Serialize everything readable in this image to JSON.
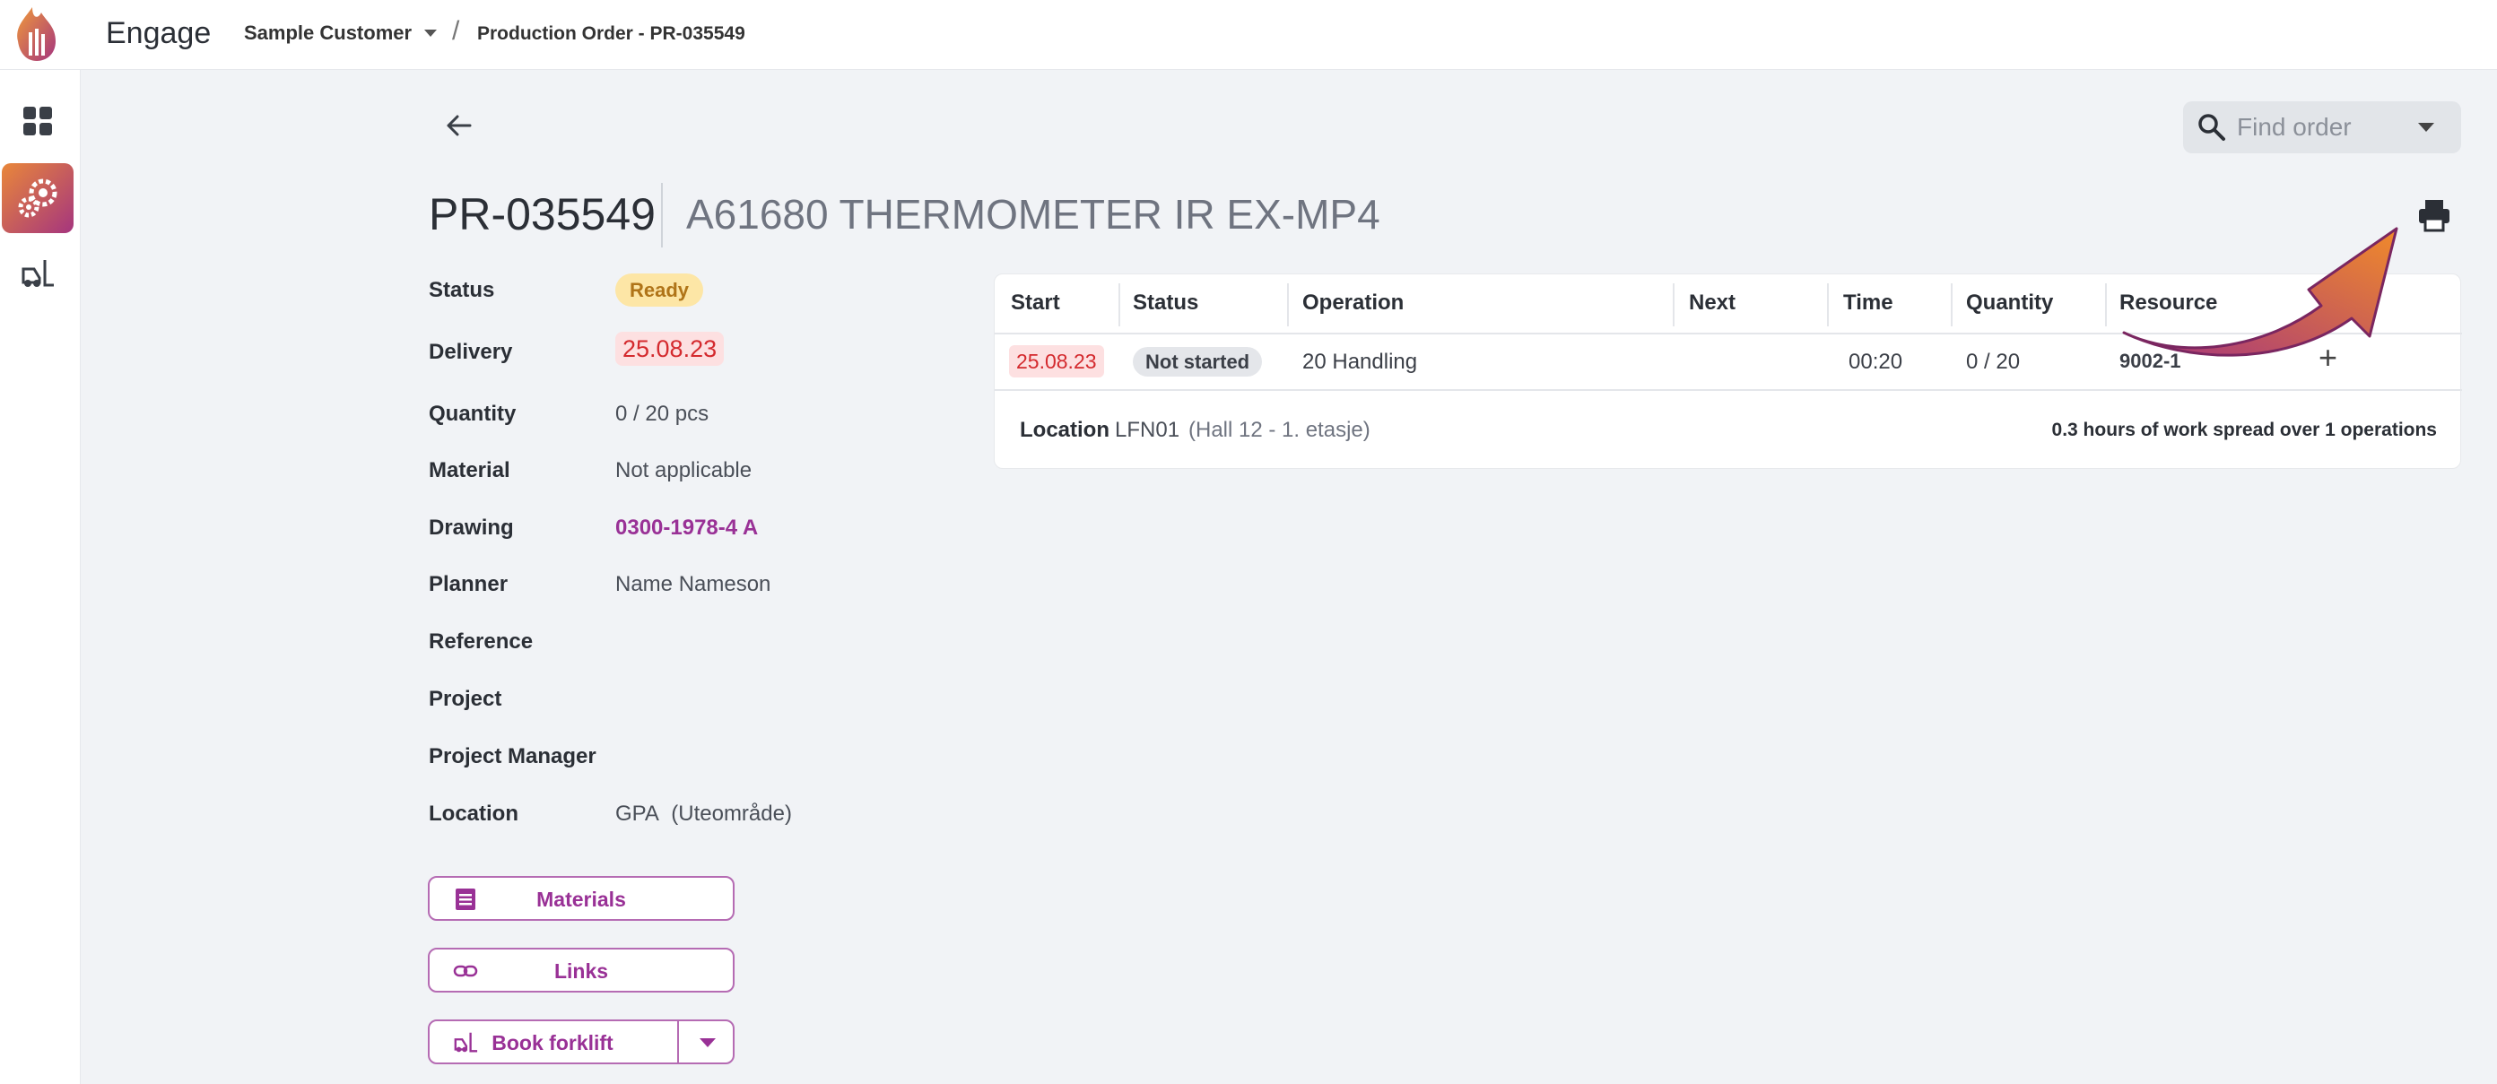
{
  "header": {
    "app_title": "Engage",
    "customer": "Sample Customer",
    "breadcrumb_sep": "/",
    "breadcrumb": "Production Order - PR-035549"
  },
  "sidebar": {
    "items": [
      {
        "icon": "dashboard-icon"
      },
      {
        "icon": "production-gear-icon",
        "active": true
      },
      {
        "icon": "forklift-icon"
      }
    ]
  },
  "search": {
    "placeholder": "Find order"
  },
  "order": {
    "number": "PR-035549",
    "description": "A61680 THERMOMETER IR EX-MP4"
  },
  "details": {
    "status_label": "Status",
    "status_value": "Ready",
    "delivery_label": "Delivery",
    "delivery_value": "25.08.23",
    "quantity_label": "Quantity",
    "quantity_value": "0 / 20 pcs",
    "material_label": "Material",
    "material_value": "Not applicable",
    "drawing_label": "Drawing",
    "drawing_value": "0300-1978-4 A",
    "planner_label": "Planner",
    "planner_value": "Name Nameson",
    "reference_label": "Reference",
    "project_label": "Project",
    "project_manager_label": "Project Manager",
    "location_label": "Location",
    "location_value": "GPA",
    "location_area": "(Uteområde)"
  },
  "buttons": {
    "materials": "Materials",
    "links": "Links",
    "book_forklift": "Book forklift"
  },
  "operations": {
    "headers": {
      "start": "Start",
      "status": "Status",
      "operation": "Operation",
      "next": "Next",
      "time": "Time",
      "quantity": "Quantity",
      "resource": "Resource"
    },
    "rows": [
      {
        "start": "25.08.23",
        "status": "Not started",
        "operation": "20 Handling",
        "next": "",
        "time": "00:20",
        "quantity": "0 / 20",
        "resource": "9002-1"
      }
    ],
    "add_symbol": "+",
    "location_label": "Location",
    "location_value": "LFN01",
    "location_hall": "(Hall 12 - 1. etasje)",
    "summary": "0.3 hours of work spread over 1 operations"
  },
  "colors": {
    "accent": "#993196",
    "gradient_start": "#e9873a",
    "gradient_end": "#a5357e",
    "ready_bg": "#fde6a6",
    "date_red": "#d42a2e"
  }
}
